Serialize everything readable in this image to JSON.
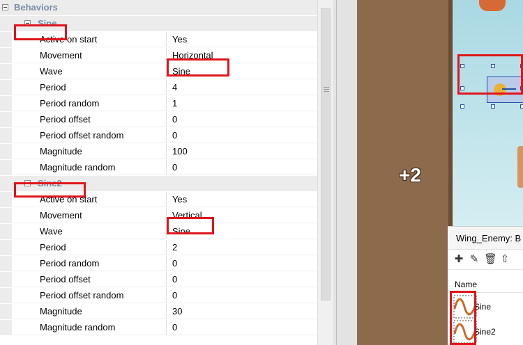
{
  "properties": {
    "category_label": "Behaviors",
    "behaviors": [
      {
        "name": "Sine",
        "props": [
          {
            "name": "Active on start",
            "value": "Yes"
          },
          {
            "name": "Movement",
            "value": "Horizontal"
          },
          {
            "name": "Wave",
            "value": "Sine"
          },
          {
            "name": "Period",
            "value": "4"
          },
          {
            "name": "Period random",
            "value": "1"
          },
          {
            "name": "Period offset",
            "value": "0"
          },
          {
            "name": "Period offset random",
            "value": "0"
          },
          {
            "name": "Magnitude",
            "value": "100"
          },
          {
            "name": "Magnitude random",
            "value": "0"
          }
        ]
      },
      {
        "name": "Sine2",
        "props": [
          {
            "name": "Active on start",
            "value": "Yes"
          },
          {
            "name": "Movement",
            "value": "Vertical"
          },
          {
            "name": "Wave",
            "value": "Sine"
          },
          {
            "name": "Period",
            "value": "2"
          },
          {
            "name": "Period random",
            "value": "0"
          },
          {
            "name": "Period offset",
            "value": "0"
          },
          {
            "name": "Period offset random",
            "value": "0"
          },
          {
            "name": "Magnitude",
            "value": "30"
          },
          {
            "name": "Magnitude random",
            "value": "0"
          }
        ]
      }
    ]
  },
  "layout_view": {
    "score_text": "+2"
  },
  "behaviors_panel": {
    "title": "Wing_Enemy: B",
    "column_name": "Name",
    "toolbar_icons": [
      "add-icon",
      "edit-icon",
      "delete-icon",
      "move-up-icon"
    ],
    "items": [
      {
        "name": "Sine",
        "icon": "sine-wave-icon"
      },
      {
        "name": "Sine2",
        "icon": "sine-wave-icon"
      }
    ]
  },
  "colors": {
    "annotation": "#e0141b",
    "category_text": "#7b8da6",
    "selection": "#2150a6",
    "wave_icon": "#d0672a"
  }
}
